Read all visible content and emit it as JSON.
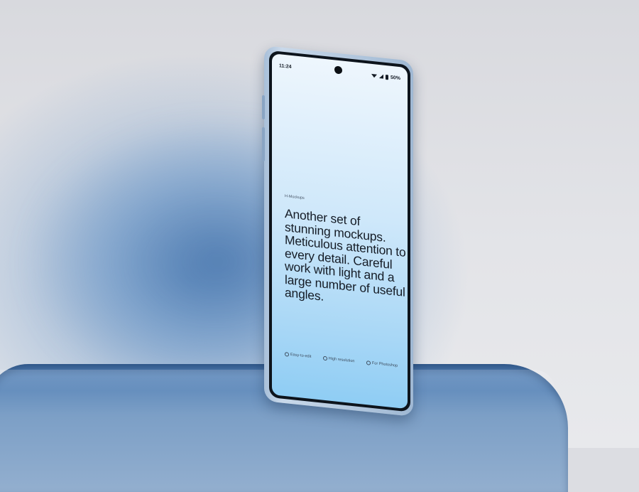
{
  "phone": {
    "status": {
      "time": "11:24",
      "battery": "50%"
    },
    "brand": "H-Mockups",
    "headline": "Another set of stunning mockups. Meticulous attention to every detail. Careful work with light and a large number of useful angles.",
    "features": [
      {
        "icon": "check-circle-icon",
        "label": "Easy-to-edit"
      },
      {
        "icon": "heart-icon",
        "label": "High resolution"
      },
      {
        "icon": "target-icon",
        "label": "For Photoshop"
      }
    ]
  },
  "colors": {
    "background": "#dcdde2",
    "platform": "#4a7ab0",
    "screen_top": "#eef6fd",
    "screen_bottom": "#8fcdf4",
    "text": "#151c26"
  }
}
